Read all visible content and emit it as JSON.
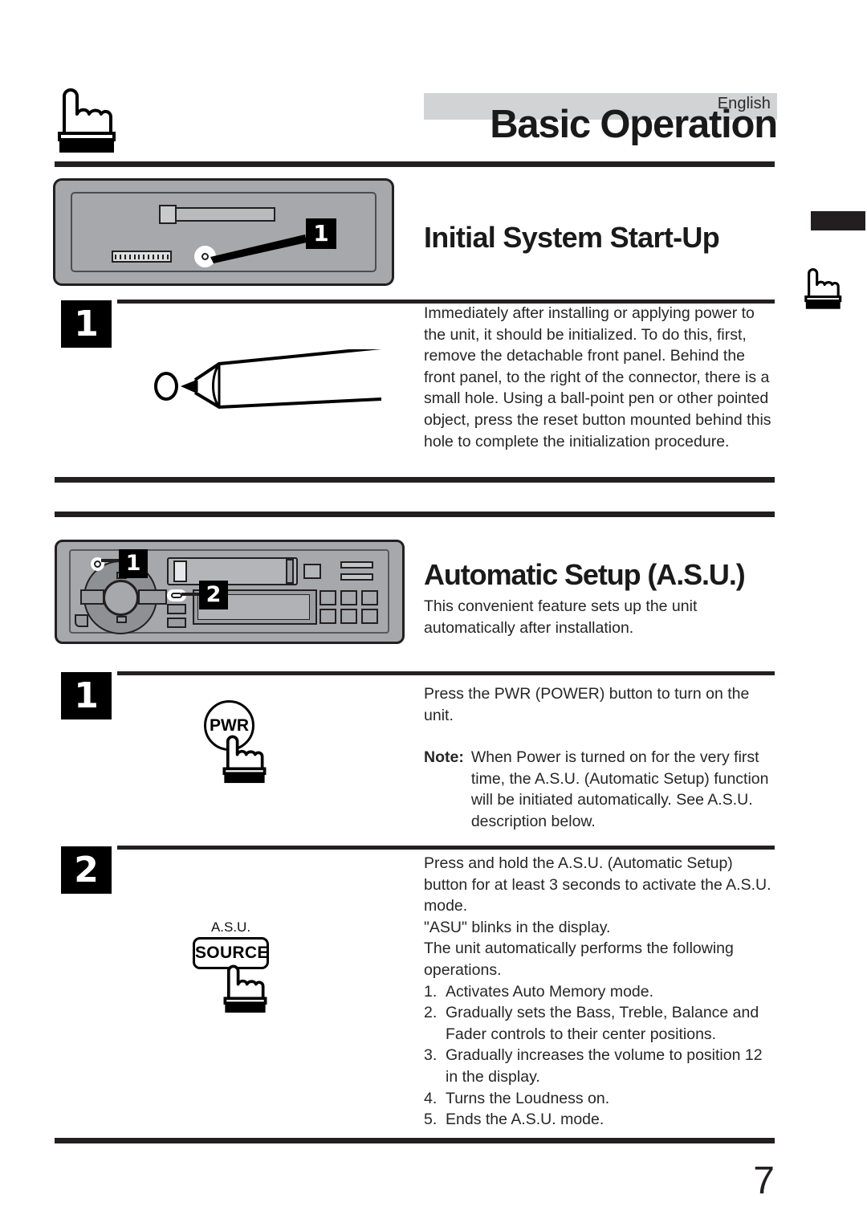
{
  "header": {
    "language": "English",
    "title": "Basic Operation"
  },
  "sections": [
    {
      "heading": "Initial System Start-Up",
      "body": "Immediately after installing or applying power to the unit, it should be initialized. To do this, first, remove the detachable front panel. Behind the front panel, to the right of the connector, there is a small hole. Using a ball-point pen or other pointed object, press the reset button mounted behind this hole to complete the initialization procedure."
    },
    {
      "heading": "Automatic Setup (A.S.U.)",
      "body": "This convenient feature sets up the unit automatically after installation."
    }
  ],
  "steps": {
    "initial": {
      "number": "1"
    },
    "power": {
      "number": "1",
      "instruction": "Press the PWR (POWER) button to turn on the unit.",
      "note_label": "Note:",
      "note_body": "When Power is turned on for the very first time, the A.S.U. (Automatic Setup) function will be initiated automatically. See A.S.U. description below."
    },
    "asu": {
      "number": "2",
      "instruction": "Press and hold the A.S.U. (Automatic Setup) button for at least 3 seconds to activate the A.S.U. mode.",
      "line2": "\"ASU\" blinks in the display.",
      "line3": "The unit automatically performs the following operations.",
      "operations": [
        {
          "num": "1.",
          "text": "Activates Auto Memory mode."
        },
        {
          "num": "2.",
          "text": "Gradually sets the Bass, Treble, Balance and Fader controls to their center positions."
        },
        {
          "num": "3.",
          "text": "Gradually increases the volume to position 12 in the display."
        },
        {
          "num": "4.",
          "text": "Turns the Loudness on."
        },
        {
          "num": "5.",
          "text": "Ends the A.S.U. mode."
        }
      ]
    }
  },
  "illustrations": {
    "device_callout_1": "1",
    "faceplate_callout_1": "1",
    "faceplate_callout_2": "2",
    "power_button_label": "PWR",
    "source_button_caption": "A.S.U.",
    "source_button_label": "SOURCE"
  },
  "footer": {
    "page_number": "7"
  },
  "colors": {
    "ink": "#231f20",
    "band": "#d2d3d4",
    "metal": "#a6a8ab"
  }
}
